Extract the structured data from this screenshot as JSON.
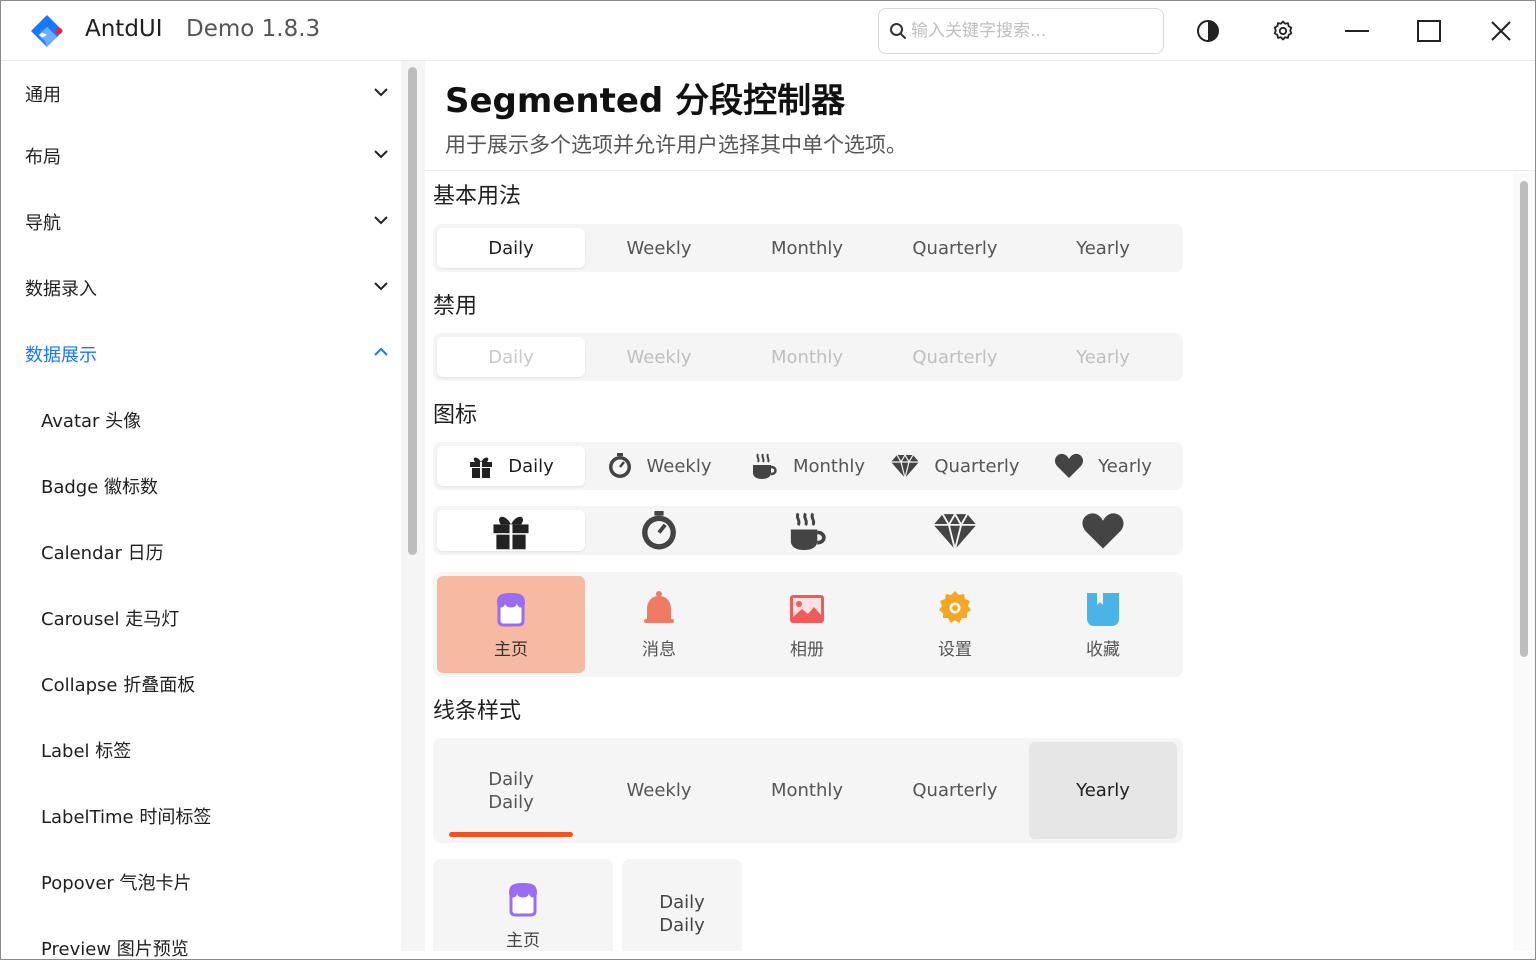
{
  "titlebar": {
    "app_name": "AntdUI",
    "version": "Demo 1.8.3",
    "search_placeholder": "输入关键字搜索..."
  },
  "sidebar": {
    "items": [
      {
        "label": "通用",
        "expanded": false
      },
      {
        "label": "布局",
        "expanded": false
      },
      {
        "label": "导航",
        "expanded": false
      },
      {
        "label": "数据录入",
        "expanded": false
      },
      {
        "label": "数据展示",
        "expanded": true,
        "active": true
      }
    ],
    "subitems": [
      "Avatar 头像",
      "Badge 徽标数",
      "Calendar 日历",
      "Carousel 走马灯",
      "Collapse 折叠面板",
      "Label 标签",
      "LabelTime 时间标签",
      "Popover 气泡卡片",
      "Preview 图片预览"
    ]
  },
  "page": {
    "title": "Segmented 分段控制器",
    "description": "用于展示多个选项并允许用户选择其中单个选项。"
  },
  "sections": {
    "basic": "基本用法",
    "disabled": "禁用",
    "icon": "图标",
    "line": "线条样式"
  },
  "options": [
    "Daily",
    "Weekly",
    "Monthly",
    "Quarterly",
    "Yearly"
  ],
  "nav_options": [
    "主页",
    "消息",
    "相册",
    "设置",
    "收藏"
  ],
  "line_first": [
    "Daily",
    "Daily"
  ],
  "bottom": {
    "card1_caption": "主页",
    "card2_lines": [
      "Daily",
      "Daily"
    ]
  },
  "icons": [
    "gift-icon",
    "stopwatch-icon",
    "coffee-icon",
    "diamond-icon",
    "heart-icon"
  ],
  "colors": {
    "accent": "#1677ff",
    "selected_bg": "#f8b9a3",
    "underline": "#f4511e",
    "icon_home": "#9a6cf0",
    "icon_bell": "#f07b64",
    "icon_photo": "#f05a5a",
    "icon_gear": "#f5a623",
    "icon_fav": "#4ab3e8"
  }
}
